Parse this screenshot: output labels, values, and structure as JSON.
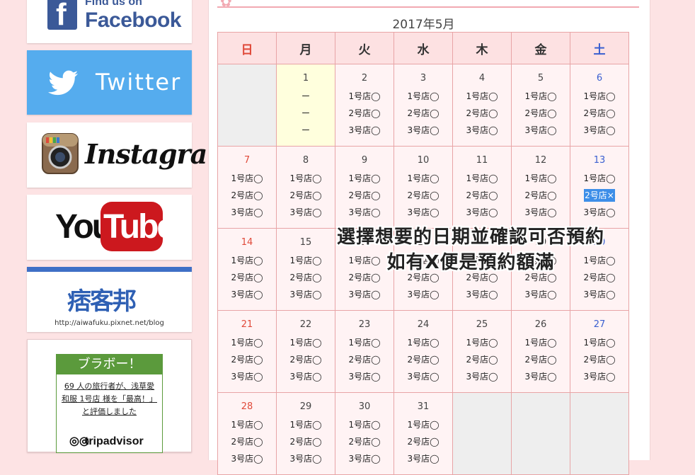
{
  "sidebar": {
    "facebook": {
      "small": "Find us on",
      "big": "Facebook"
    },
    "twitter": {
      "label": "Twitter"
    },
    "instagram": {
      "label": "Instagram"
    },
    "youtube": {
      "you": "You",
      "tube": "Tube"
    },
    "pixnet": {
      "logo": "痞客邦",
      "url": "http://aiwafuku.pixnet.net/blog"
    },
    "tripadvisor": {
      "header": "ブラボー！",
      "text": "69 人の旅行者が、浅草愛和服 1号店 様を「最高！」と評価しました",
      "logo": "tripadvisor"
    }
  },
  "calendar": {
    "month": "2017年5月",
    "weekdays": [
      "日",
      "月",
      "火",
      "水",
      "木",
      "金",
      "土"
    ],
    "weeks": [
      [
        null,
        {
          "d": "1",
          "s": [
            "ー",
            "ー",
            "ー"
          ],
          "today": true
        },
        {
          "d": "2",
          "s": [
            "1号店◯",
            "2号店◯",
            "3号店◯"
          ]
        },
        {
          "d": "3",
          "s": [
            "1号店◯",
            "2号店◯",
            "3号店◯"
          ]
        },
        {
          "d": "4",
          "s": [
            "1号店◯",
            "2号店◯",
            "3号店◯"
          ]
        },
        {
          "d": "5",
          "s": [
            "1号店◯",
            "2号店◯",
            "3号店◯"
          ]
        },
        {
          "d": "6",
          "s": [
            "1号店◯",
            "2号店◯",
            "3号店◯"
          ]
        }
      ],
      [
        {
          "d": "7",
          "s": [
            "1号店◯",
            "2号店◯",
            "3号店◯"
          ]
        },
        {
          "d": "8",
          "s": [
            "1号店◯",
            "2号店◯",
            "3号店◯"
          ]
        },
        {
          "d": "9",
          "s": [
            "1号店◯",
            "2号店◯",
            "3号店◯"
          ]
        },
        {
          "d": "10",
          "s": [
            "1号店◯",
            "2号店◯",
            "3号店◯"
          ]
        },
        {
          "d": "11",
          "s": [
            "1号店◯",
            "2号店◯",
            "3号店◯"
          ]
        },
        {
          "d": "12",
          "s": [
            "1号店◯",
            "2号店◯",
            "3号店◯"
          ]
        },
        {
          "d": "13",
          "s": [
            "1号店◯",
            "2号店×",
            "3号店◯"
          ],
          "sel": 1
        }
      ],
      [
        {
          "d": "14",
          "s": [
            "1号店◯",
            "2号店◯",
            "3号店◯"
          ]
        },
        {
          "d": "15",
          "s": [
            "1号店◯",
            "2号店◯",
            "3号店◯"
          ]
        },
        {
          "d": "16",
          "s": [
            "1号店◯",
            "2号店◯",
            "3号店◯"
          ]
        },
        {
          "d": "17",
          "s": [
            "1号店◯",
            "2号店◯",
            "3号店◯"
          ]
        },
        {
          "d": "18",
          "s": [
            "1号店◯",
            "2号店◯",
            "3号店◯"
          ]
        },
        {
          "d": "19",
          "s": [
            "1号店◯",
            "2号店◯",
            "3号店◯"
          ]
        },
        {
          "d": "20",
          "s": [
            "1号店◯",
            "2号店◯",
            "3号店◯"
          ]
        }
      ],
      [
        {
          "d": "21",
          "s": [
            "1号店◯",
            "2号店◯",
            "3号店◯"
          ]
        },
        {
          "d": "22",
          "s": [
            "1号店◯",
            "2号店◯",
            "3号店◯"
          ]
        },
        {
          "d": "23",
          "s": [
            "1号店◯",
            "2号店◯",
            "3号店◯"
          ]
        },
        {
          "d": "24",
          "s": [
            "1号店◯",
            "2号店◯",
            "3号店◯"
          ]
        },
        {
          "d": "25",
          "s": [
            "1号店◯",
            "2号店◯",
            "3号店◯"
          ]
        },
        {
          "d": "26",
          "s": [
            "1号店◯",
            "2号店◯",
            "3号店◯"
          ]
        },
        {
          "d": "27",
          "s": [
            "1号店◯",
            "2号店◯",
            "3号店◯"
          ]
        }
      ],
      [
        {
          "d": "28",
          "s": [
            "1号店◯",
            "2号店◯",
            "3号店◯"
          ]
        },
        {
          "d": "29",
          "s": [
            "1号店◯",
            "2号店◯",
            "3号店◯"
          ]
        },
        {
          "d": "30",
          "s": [
            "1号店◯",
            "2号店◯",
            "3号店◯"
          ]
        },
        {
          "d": "31",
          "s": [
            "1号店◯",
            "2号店◯",
            "3号店◯"
          ]
        },
        null,
        null,
        null
      ]
    ]
  },
  "overlay": {
    "line1": "選擇想要的日期並確認可否預約",
    "line2": "如有X便是預約額滿"
  }
}
